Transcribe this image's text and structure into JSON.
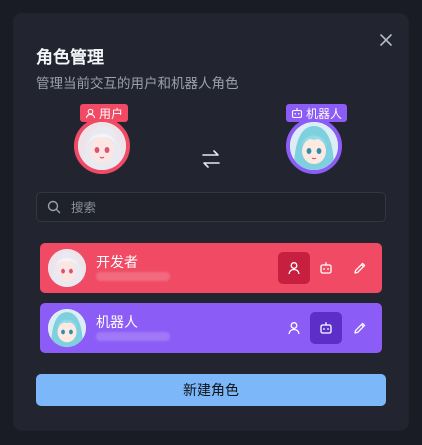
{
  "dialog": {
    "title": "角色管理",
    "subtitle": "管理当前交互的用户和机器人角色",
    "close_icon": "close-icon"
  },
  "current": {
    "user_tag": "用户",
    "bot_tag": "机器人",
    "swap_icon": "swap-icon"
  },
  "search": {
    "placeholder": "搜索",
    "value": ""
  },
  "roles": [
    {
      "name": "开发者",
      "color": "#f04a64",
      "active_action": "set-user"
    },
    {
      "name": "机器人",
      "color": "#8c5cf6",
      "active_action": "set-bot"
    }
  ],
  "actions": {
    "new_role_label": "新建角色"
  },
  "colors": {
    "background": "#191c24",
    "dialog": "#22252f",
    "user_accent": "#f04a64",
    "bot_accent": "#8c5cf6",
    "primary_button": "#7cb8f9"
  }
}
